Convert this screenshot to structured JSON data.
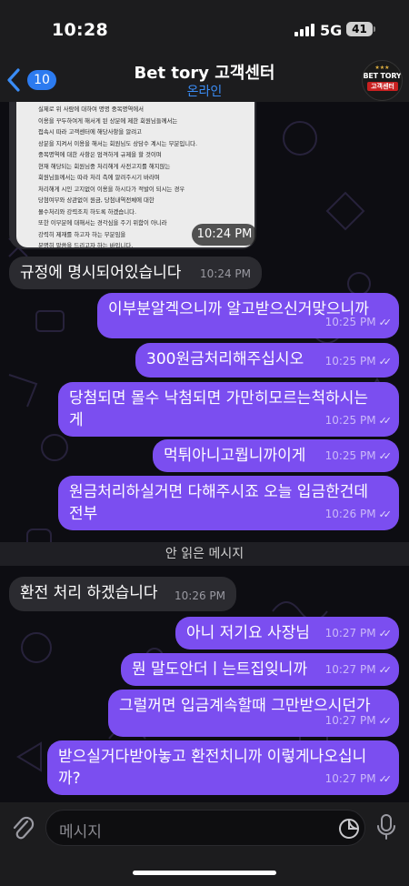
{
  "status_bar": {
    "time": "10:28",
    "network": "5G",
    "battery": "41"
  },
  "header": {
    "back_count": "10",
    "title": "Bet tory 고객센터",
    "status": "온라인",
    "avatar_line1": "BET TORY",
    "avatar_line2": "고객센터"
  },
  "document": {
    "lines": [
      "실제로 위 사람에 대하여 명명 중복명역에서",
      "이용을 꾸두하여게 해서게 된 상분에 제한 회원님들께서는",
      "",
      "접속시 따라 고객센터에 해당사항을 알려고",
      "상분을 지켜서 이용을 해서는 회원님도 상담수 계시는 부분입니다.",
      "",
      "중복명역에 대한 사항은 엄격하게 규제을 할 것이며",
      "현재 해당되는 회원님중 처리해게 사전고지를 해지않는",
      "",
      "회원님들께서는 따라 처리 측에 알려주시기 바라며",
      "처리해게 시인 고지없이 이용을 하시다가 적발이 되시는 경우",
      "",
      "당첨여부와 상관없이 원금, 당첨내역전체에 대한",
      "몰수처리와 강력조치 하도록 하겠습니다.",
      "",
      "또한 이부분에 대해서는 경각심을 주기 위함이 아니라",
      "강력히 제재를 하고자 하는 부분임을",
      "분명히 말씀을 드리고자 하는 바입니다."
    ],
    "time": "10:24 PM"
  },
  "messages": [
    {
      "id": "m1",
      "dir": "in",
      "text": "규정에 명시되어있습니다",
      "time": "10:24 PM"
    },
    {
      "id": "m2",
      "dir": "out",
      "text": "이부분알겍으니까 알고받으신거맞으니까",
      "time": "10:25 PM"
    },
    {
      "id": "m3",
      "dir": "out",
      "text": "300원금처리해주십시오",
      "time": "10:25 PM"
    },
    {
      "id": "m4",
      "dir": "out",
      "text": "당첨되면 몰수 낙첨되면 가만히모르는척하시는게",
      "line1": "당첨되면 몰수 낙첨되면 가만히모르는척하시는",
      "line2": "게",
      "time": "10:25 PM"
    },
    {
      "id": "m5",
      "dir": "out",
      "text": "먹튀아니고뭡니까이게",
      "time": "10:25 PM"
    },
    {
      "id": "m6",
      "dir": "out",
      "text": "원금처리하실거면 다해주시죠 오늘 입금한건데 전부",
      "line1": "원금처리하실거면 다해주시죠 오늘 입금한건데",
      "line2": "전부",
      "time": "10:26 PM"
    },
    {
      "id": "m7",
      "dir": "in",
      "text": "환전 처리 하겠습니다",
      "time": "10:26 PM"
    },
    {
      "id": "m8",
      "dir": "out",
      "text": "아니 저기요 사장님",
      "time": "10:27 PM"
    },
    {
      "id": "m9",
      "dir": "out",
      "text": "뭔 말도안더ㅣ는트집잊니까",
      "time": "10:27 PM"
    },
    {
      "id": "m10",
      "dir": "out",
      "text": "그럴꺼면 입금계속할때 그만받으시던가",
      "time": "10:27 PM"
    },
    {
      "id": "m11",
      "dir": "out",
      "text": "받으실거다받아놓고 환전치니까 이렇게나오십니까?",
      "line1": "받으실거다받아놓고 환전치니까 이렇게나오십니",
      "line2": "까?",
      "time": "10:27 PM"
    }
  ],
  "unread_label": "안 읽은 메시지",
  "input": {
    "placeholder": "메시지"
  },
  "colors": {
    "outgoing": "#7b4ef0",
    "incoming": "#2b2b30",
    "accent": "#2c7bf0"
  },
  "icons": [
    "back-chevron-icon",
    "signal-icon",
    "battery-icon",
    "attach-icon",
    "sticker-icon",
    "mic-icon",
    "read-checks-icon"
  ]
}
